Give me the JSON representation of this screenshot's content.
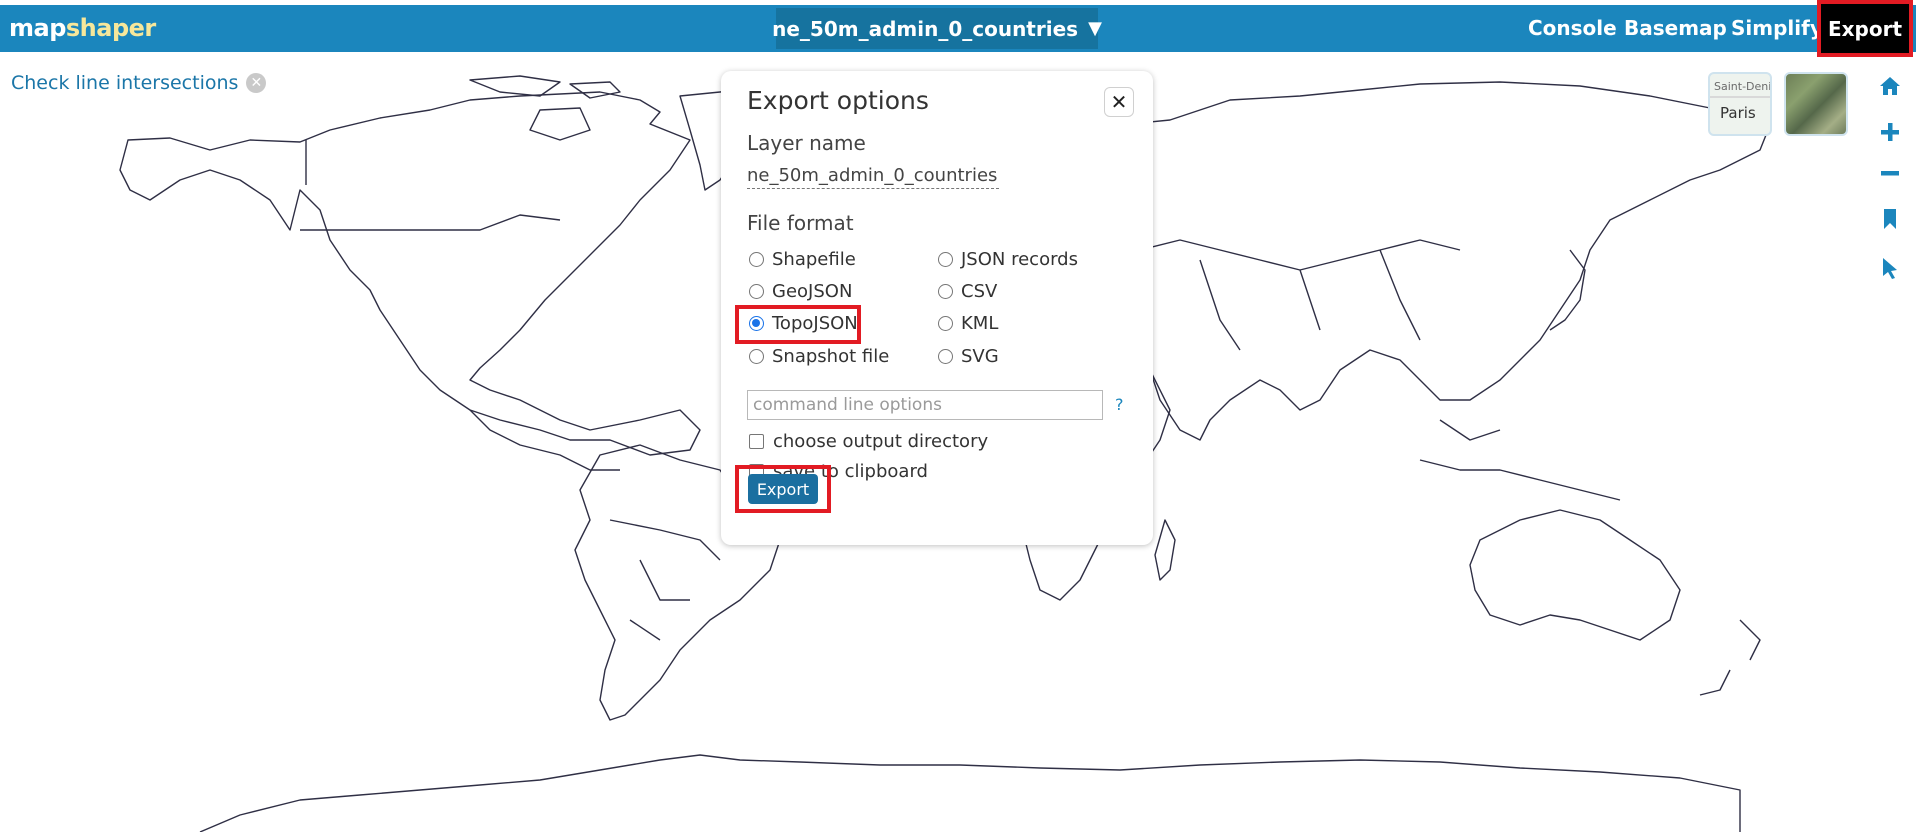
{
  "app": {
    "logo_part1": "map",
    "logo_part2": "shaper",
    "brand_color": "#1b86bd",
    "accent_color": "#f6e79b"
  },
  "header": {
    "layer_selector": "ne_50m_admin_0_countries",
    "layer_selector_icon": "triangle-down-icon",
    "nav": {
      "console": "Console",
      "basemap": "Basemap",
      "simplify": "Simplify",
      "export": "Export"
    }
  },
  "map": {
    "check_intersections": "Check line intersections",
    "basemaps": {
      "street_thumb_labels": [
        "Saint-Deni",
        "Paris"
      ],
      "satellite_thumb": "satellite"
    },
    "tools": [
      "home-icon",
      "zoom-in-icon",
      "zoom-out-icon",
      "bookmark-icon",
      "pointer-icon"
    ]
  },
  "export_dialog": {
    "title": "Export options",
    "layer_name_label": "Layer name",
    "layer_name_value": "ne_50m_admin_0_countries",
    "file_format_label": "File format",
    "formats_left": [
      "Shapefile",
      "GeoJSON",
      "TopoJSON",
      "Snapshot file"
    ],
    "formats_right": [
      "JSON records",
      "CSV",
      "KML",
      "SVG"
    ],
    "selected_format": "TopoJSON",
    "command_placeholder": "command line options",
    "help": "?",
    "option_output_dir": "choose output directory",
    "option_clipboard": "save to clipboard",
    "export_button": "Export",
    "highlight_color": "#e21b23"
  }
}
